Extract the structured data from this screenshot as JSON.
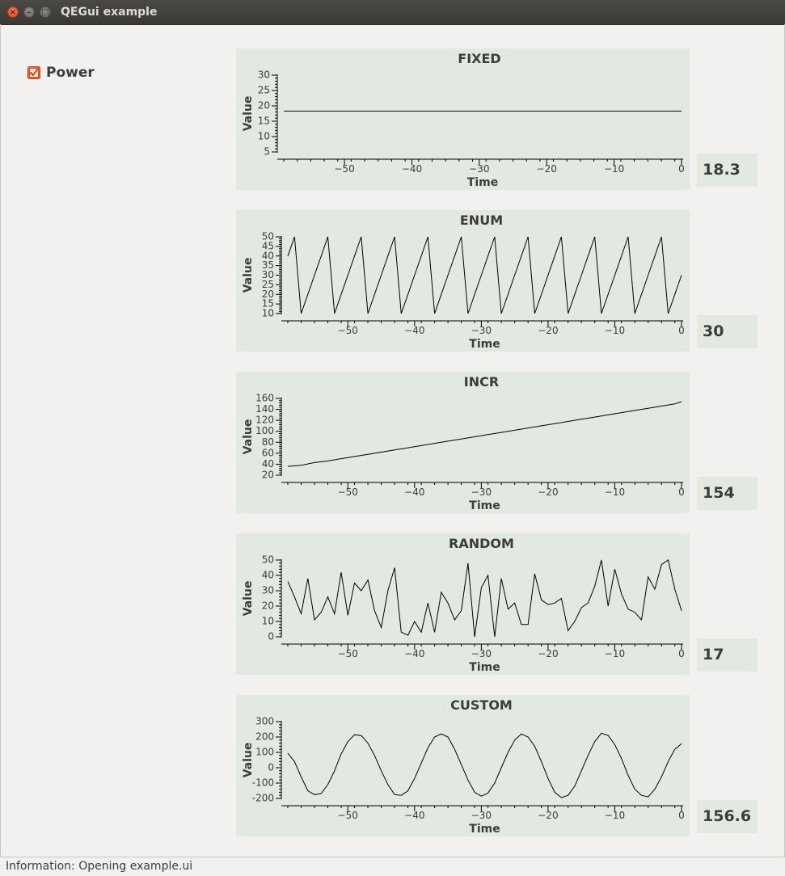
{
  "window": {
    "title": "QEGui example"
  },
  "power": {
    "label": "Power",
    "checked": true
  },
  "status": {
    "text": "Information: Opening example.ui"
  },
  "readouts": [
    "18.3",
    "30",
    "154",
    "17",
    "156.6"
  ],
  "chart_data": [
    {
      "type": "line",
      "title": "FIXED",
      "xlabel": "Time",
      "ylabel": "Value",
      "xlim": [
        -59,
        0
      ],
      "ylim": [
        5,
        30
      ],
      "xticks": [
        -50,
        -40,
        -30,
        -20,
        -10,
        0
      ],
      "yticks": [
        5,
        10,
        15,
        20,
        25,
        30
      ],
      "x": [
        -59,
        0
      ],
      "values": [
        18.3,
        18.3
      ]
    },
    {
      "type": "line",
      "title": "ENUM",
      "xlabel": "Time",
      "ylabel": "Value",
      "xlim": [
        -59,
        0
      ],
      "ylim": [
        10,
        50
      ],
      "xticks": [
        -50,
        -40,
        -30,
        -20,
        -10,
        0
      ],
      "yticks": [
        10,
        15,
        20,
        25,
        30,
        35,
        40,
        45,
        50
      ],
      "x": [
        -59,
        -58,
        -57,
        -56,
        -55,
        -54,
        -53,
        -52,
        -51,
        -50,
        -49,
        -48,
        -47,
        -46,
        -45,
        -44,
        -43,
        -42,
        -41,
        -40,
        -39,
        -38,
        -37,
        -36,
        -35,
        -34,
        -33,
        -32,
        -31,
        -30,
        -29,
        -28,
        -27,
        -26,
        -25,
        -24,
        -23,
        -22,
        -21,
        -20,
        -19,
        -18,
        -17,
        -16,
        -15,
        -14,
        -13,
        -12,
        -11,
        -10,
        -9,
        -8,
        -7,
        -6,
        -5,
        -4,
        -3,
        -2,
        -1,
        0
      ],
      "values": [
        40,
        50,
        10,
        20,
        30,
        40,
        50,
        10,
        20,
        30,
        40,
        50,
        10,
        20,
        30,
        40,
        50,
        10,
        20,
        30,
        40,
        50,
        10,
        20,
        30,
        40,
        50,
        10,
        20,
        30,
        40,
        50,
        10,
        20,
        30,
        40,
        50,
        10,
        20,
        30,
        40,
        50,
        10,
        20,
        30,
        40,
        50,
        10,
        20,
        30,
        40,
        50,
        10,
        20,
        30,
        40,
        50,
        10,
        20,
        30
      ]
    },
    {
      "type": "line",
      "title": "INCR",
      "xlabel": "Time",
      "ylabel": "Value",
      "xlim": [
        -59,
        0
      ],
      "ylim": [
        20,
        160
      ],
      "xticks": [
        -50,
        -40,
        -30,
        -20,
        -10,
        0
      ],
      "yticks": [
        20,
        40,
        60,
        80,
        100,
        120,
        140,
        160
      ],
      "x": [
        -59,
        -57,
        -55,
        -53,
        -51,
        -49,
        -47,
        -45,
        -43,
        -41,
        -39,
        -37,
        -35,
        -33,
        -31,
        -29,
        -27,
        -25,
        -23,
        -21,
        -19,
        -17,
        -15,
        -13,
        -11,
        -9,
        -7,
        -5,
        -3,
        -1,
        0
      ],
      "values": [
        36,
        38,
        43,
        46,
        50,
        54,
        58,
        62,
        66,
        70,
        74,
        78,
        82,
        86,
        90,
        94,
        98,
        102,
        106,
        110,
        114,
        118,
        122,
        126,
        130,
        134,
        138,
        142,
        146,
        150,
        154
      ]
    },
    {
      "type": "line",
      "title": "RANDOM",
      "xlabel": "Time",
      "ylabel": "Value",
      "xlim": [
        -59,
        0
      ],
      "ylim": [
        0,
        50
      ],
      "xticks": [
        -50,
        -40,
        -30,
        -20,
        -10,
        0
      ],
      "yticks": [
        0,
        10,
        20,
        30,
        40,
        50
      ],
      "x": [
        -59,
        -58,
        -57,
        -56,
        -55,
        -54,
        -53,
        -52,
        -51,
        -50,
        -49,
        -48,
        -47,
        -46,
        -45,
        -44,
        -43,
        -42,
        -41,
        -40,
        -39,
        -38,
        -37,
        -36,
        -35,
        -34,
        -33,
        -32,
        -31,
        -30,
        -29,
        -28,
        -27,
        -26,
        -25,
        -24,
        -23,
        -22,
        -21,
        -20,
        -19,
        -18,
        -17,
        -16,
        -15,
        -14,
        -13,
        -12,
        -11,
        -10,
        -9,
        -8,
        -7,
        -6,
        -5,
        -4,
        -3,
        -2,
        -1,
        0
      ],
      "values": [
        36,
        26,
        15,
        38,
        11,
        16,
        26,
        15,
        42,
        14,
        35,
        30,
        37,
        17,
        6,
        30,
        45,
        3,
        1,
        10,
        3,
        22,
        3,
        29,
        22,
        11,
        17,
        48,
        0,
        32,
        40,
        0,
        38,
        18,
        22,
        8,
        8,
        41,
        24,
        21,
        22,
        25,
        4,
        10,
        19,
        22,
        33,
        50,
        20,
        44,
        28,
        18,
        16,
        11,
        39,
        31,
        47,
        50,
        31,
        17
      ]
    },
    {
      "type": "line",
      "title": "CUSTOM",
      "xlabel": "Time",
      "ylabel": "Value",
      "xlim": [
        -59,
        0
      ],
      "ylim": [
        -200,
        300
      ],
      "xticks": [
        -50,
        -40,
        -30,
        -20,
        -10,
        0
      ],
      "yticks": [
        -200,
        -100,
        0,
        100,
        200,
        300
      ],
      "x": [
        -59,
        -58,
        -57,
        -56,
        -55,
        -54,
        -53,
        -52,
        -51,
        -50,
        -49,
        -48,
        -47,
        -46,
        -45,
        -44,
        -43,
        -42,
        -41,
        -40,
        -39,
        -38,
        -37,
        -36,
        -35,
        -34,
        -33,
        -32,
        -31,
        -30,
        -29,
        -28,
        -27,
        -26,
        -25,
        -24,
        -23,
        -22,
        -21,
        -20,
        -19,
        -18,
        -17,
        -16,
        -15,
        -14,
        -13,
        -12,
        -11,
        -10,
        -9,
        -8,
        -7,
        -6,
        -5,
        -4,
        -3,
        -2,
        -1,
        0
      ],
      "values": [
        95,
        40,
        -60,
        -150,
        -175,
        -168,
        -110,
        -20,
        90,
        170,
        215,
        210,
        160,
        80,
        -20,
        -110,
        -175,
        -180,
        -150,
        -70,
        30,
        130,
        200,
        220,
        200,
        120,
        20,
        -80,
        -160,
        -185,
        -165,
        -100,
        0,
        100,
        180,
        220,
        200,
        140,
        40,
        -70,
        -160,
        -195,
        -180,
        -120,
        -20,
        80,
        170,
        225,
        210,
        150,
        60,
        -50,
        -140,
        -180,
        -190,
        -140,
        -60,
        40,
        120,
        156.6
      ]
    }
  ]
}
